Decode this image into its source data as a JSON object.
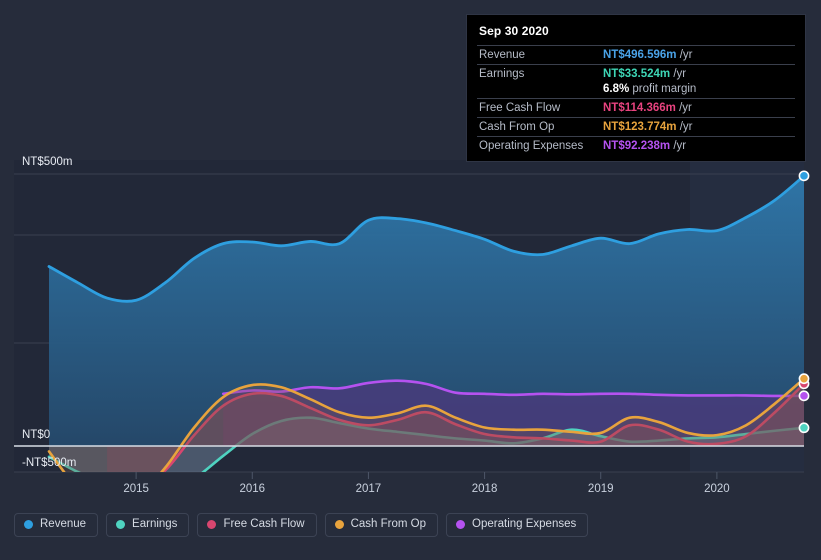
{
  "chart_data": {
    "type": "area",
    "title": "",
    "xlabel": "",
    "ylabel": "",
    "ylim": [
      -500,
      650
    ],
    "grid": true,
    "legend_position": "bottom",
    "currency": "NT$",
    "units": "m",
    "y_ticks": [
      "NT$500m",
      "NT$0",
      "-NT$500m"
    ],
    "y_tick_values": [
      500,
      0,
      -500
    ],
    "x_ticks": [
      "2015",
      "2016",
      "2017",
      "2018",
      "2019",
      "2020"
    ],
    "x_tick_values": [
      2015,
      2016,
      2017,
      2018,
      2019,
      2020
    ],
    "series": [
      {
        "name": "Revenue",
        "color": "#2e9fe0",
        "fill": "#1d5f87",
        "x": [
          2014.25,
          2014.5,
          2014.75,
          2015.0,
          2015.25,
          2015.5,
          2015.75,
          2016.0,
          2016.25,
          2016.5,
          2016.75,
          2017.0,
          2017.25,
          2017.5,
          2017.75,
          2018.0,
          2018.25,
          2018.5,
          2018.75,
          2019.0,
          2019.25,
          2019.5,
          2019.75,
          2020.0,
          2020.25,
          2020.5,
          2020.75
        ],
        "values": [
          330,
          300,
          272,
          268,
          300,
          345,
          372,
          375,
          368,
          376,
          372,
          415,
          418,
          410,
          396,
          380,
          358,
          352,
          368,
          382,
          372,
          390,
          398,
          396,
          420,
          452,
          496.596
        ]
      },
      {
        "name": "Earnings",
        "color": "#4fd3c0",
        "fill": "#6c7d95",
        "x": [
          2014.25,
          2014.5,
          2014.75,
          2015.0,
          2015.25,
          2015.5,
          2015.75,
          2016.0,
          2016.25,
          2016.5,
          2016.75,
          2017.0,
          2017.25,
          2017.5,
          2017.75,
          2018.0,
          2018.25,
          2018.5,
          2018.75,
          2019.0,
          2019.25,
          2019.5,
          2019.75,
          2020.0,
          2020.25,
          2020.5,
          2020.75
        ],
        "values": [
          -20,
          -48,
          -70,
          -80,
          -85,
          -60,
          -18,
          22,
          46,
          52,
          42,
          32,
          26,
          20,
          14,
          10,
          5,
          14,
          30,
          18,
          8,
          10,
          14,
          16,
          22,
          28,
          33.524
        ]
      },
      {
        "name": "Free Cash Flow",
        "color": "#d8466f",
        "fill": "#7a4a64",
        "x": [
          2014.75,
          2015.0,
          2015.25,
          2015.5,
          2015.75,
          2016.0,
          2016.25,
          2016.5,
          2016.75,
          2017.0,
          2017.25,
          2017.5,
          2017.75,
          2018.0,
          2018.25,
          2018.5,
          2018.75,
          2019.0,
          2019.25,
          2019.5,
          2019.75,
          2020.0,
          2020.25,
          2020.5,
          2020.75
        ],
        "values": [
          -88,
          -80,
          -45,
          20,
          74,
          96,
          92,
          70,
          48,
          38,
          48,
          62,
          40,
          22,
          16,
          14,
          10,
          8,
          38,
          30,
          8,
          4,
          18,
          62,
          114.366
        ]
      },
      {
        "name": "Cash From Op",
        "color": "#e8a33d",
        "fill": "#7a5a48",
        "x": [
          2014.25,
          2014.5,
          2014.75,
          2015.0,
          2015.25,
          2015.5,
          2015.75,
          2016.0,
          2016.25,
          2016.5,
          2016.75,
          2017.0,
          2017.25,
          2017.5,
          2017.75,
          2018.0,
          2018.25,
          2018.5,
          2018.75,
          2019.0,
          2019.25,
          2019.5,
          2019.75,
          2020.0,
          2020.25,
          2020.5,
          2020.75
        ],
        "values": [
          -10,
          -78,
          -108,
          -95,
          -40,
          34,
          90,
          112,
          108,
          86,
          62,
          52,
          60,
          74,
          52,
          34,
          30,
          30,
          26,
          24,
          52,
          44,
          24,
          20,
          38,
          78,
          123.774
        ]
      },
      {
        "name": "Operating Expenses",
        "color": "#b552f0",
        "fill": "#4b3a7c",
        "x": [
          2015.75,
          2016.0,
          2016.25,
          2016.5,
          2016.75,
          2017.0,
          2017.25,
          2017.5,
          2017.75,
          2018.0,
          2018.25,
          2018.5,
          2018.75,
          2019.0,
          2019.25,
          2019.5,
          2019.75,
          2020.0,
          2020.25,
          2020.5,
          2020.75
        ],
        "values": [
          96,
          102,
          100,
          108,
          106,
          116,
          120,
          114,
          98,
          96,
          94,
          96,
          95,
          96,
          96,
          94,
          93,
          93,
          93,
          92,
          92.238
        ]
      }
    ]
  },
  "tooltip": {
    "date": "Sep 30 2020",
    "rows": [
      {
        "key": "Revenue",
        "amount": "NT$496.596m",
        "unit": " /yr",
        "color": "#4aa3e8"
      },
      {
        "key": "Earnings",
        "amount": "NT$33.524m",
        "unit": " /yr",
        "color": "#3ed6b6"
      },
      {
        "key": "Free Cash Flow",
        "amount": "NT$114.366m",
        "unit": " /yr",
        "color": "#e8437f"
      },
      {
        "key": "Cash From Op",
        "amount": "NT$123.774m",
        "unit": " /yr",
        "color": "#e8a33d"
      },
      {
        "key": "Operating Expenses",
        "amount": "NT$92.238m",
        "unit": " /yr",
        "color": "#b552f0"
      }
    ],
    "margin_value": "6.8%",
    "margin_label": " profit margin"
  },
  "legend": {
    "items": [
      {
        "label": "Revenue",
        "color": "#2e9fe0"
      },
      {
        "label": "Earnings",
        "color": "#4fd3c0"
      },
      {
        "label": "Free Cash Flow",
        "color": "#d8466f"
      },
      {
        "label": "Cash From Op",
        "color": "#e8a33d"
      },
      {
        "label": "Operating Expenses",
        "color": "#b552f0"
      }
    ]
  }
}
